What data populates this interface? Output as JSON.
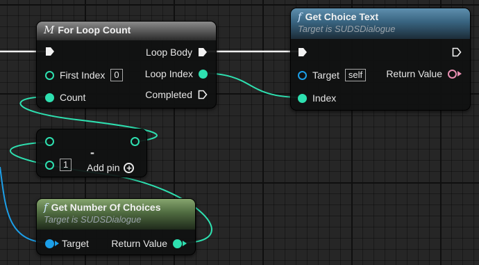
{
  "nodes": {
    "for_loop": {
      "icon": "macro-icon",
      "glyph": "M",
      "title": "For Loop Count",
      "pins": {
        "first_index_label": "First Index",
        "first_index_value": "0",
        "count_label": "Count",
        "loop_body_label": "Loop Body",
        "loop_index_label": "Loop Index",
        "completed_label": "Completed"
      }
    },
    "get_choice_text": {
      "icon": "function-icon",
      "glyph": "f",
      "title": "Get Choice Text",
      "subtitle": "Target is SUDSDialogue",
      "pins": {
        "target_label": "Target",
        "target_value": "self",
        "index_label": "Index",
        "return_label": "Return Value"
      }
    },
    "subtract": {
      "symbol": "-",
      "input_value": "1",
      "add_pin_label": "Add pin",
      "add_pin_icon": "plus-circle-icon"
    },
    "get_number_of_choices": {
      "icon": "function-icon",
      "glyph": "f",
      "title": "Get Number Of Choices",
      "subtitle": "Target is SUDSDialogue",
      "pins": {
        "target_label": "Target",
        "return_label": "Return Value"
      }
    }
  },
  "colors": {
    "exec": "#ffffff",
    "int_pin": "#2ee0b0",
    "object_pin": "#1c9fe8",
    "string_pin": "#e98fb2",
    "macro_header": "#7a7a7a",
    "function_header": "#3f6f8f",
    "pure_function_header": "#5a7a48"
  }
}
